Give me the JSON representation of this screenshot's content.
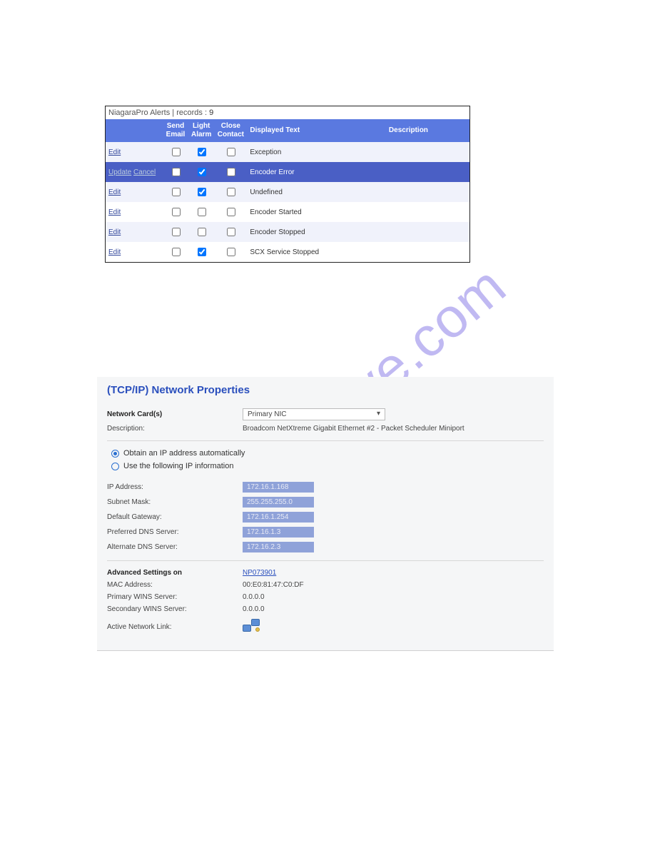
{
  "watermark": "manualshive.com",
  "alerts": {
    "title_prefix": "NiagaraPro Alerts",
    "records_label": "records :",
    "records_count": "9",
    "headers": {
      "action": "",
      "send_email": "Send\nEmail",
      "light_alarm": "Light\nAlarm",
      "close_contact": "Close\nContact",
      "displayed_text": "Displayed Text",
      "description": "Description"
    },
    "edit_label": "Edit",
    "update_label": "Update",
    "cancel_label": "Cancel",
    "rows": [
      {
        "action": "edit",
        "send_email": false,
        "light_alarm": true,
        "close_contact": false,
        "displayed_text": "Exception",
        "description": "",
        "style": "a"
      },
      {
        "action": "update_cancel",
        "send_email": false,
        "light_alarm": true,
        "close_contact": false,
        "displayed_text": "Encoder Error",
        "description": "",
        "style": "sel"
      },
      {
        "action": "edit",
        "send_email": false,
        "light_alarm": true,
        "close_contact": false,
        "displayed_text": "Undefined",
        "description": "",
        "style": "a"
      },
      {
        "action": "edit",
        "send_email": false,
        "light_alarm": false,
        "close_contact": false,
        "displayed_text": "Encoder Started",
        "description": "",
        "style": "b"
      },
      {
        "action": "edit",
        "send_email": false,
        "light_alarm": false,
        "close_contact": false,
        "displayed_text": "Encoder Stopped",
        "description": "",
        "style": "a"
      },
      {
        "action": "edit",
        "send_email": false,
        "light_alarm": true,
        "close_contact": false,
        "displayed_text": "SCX Service Stopped",
        "description": "",
        "style": "b"
      }
    ]
  },
  "network": {
    "title": "(TCP/IP) Network Properties",
    "card_label": "Network Card(s)",
    "card_value": "Primary NIC",
    "desc_label": "Description:",
    "desc_value": "Broadcom NetXtreme Gigabit Ethernet #2 - Packet Scheduler Miniport",
    "radio_auto": "Obtain an IP address automatically",
    "radio_manual": "Use the following IP information",
    "ip_label": "IP Address:",
    "ip_value": "172.16.1.168",
    "subnet_label": "Subnet Mask:",
    "subnet_value": "255.255.255.0",
    "gateway_label": "Default Gateway:",
    "gateway_value": "172.16.1.254",
    "pdns_label": "Preferred DNS Server:",
    "pdns_value": "172.16.1.3",
    "adns_label": "Alternate DNS Server:",
    "adns_value": "172.16.2.3",
    "adv_label": "Advanced Settings on",
    "adv_link": "NP073901",
    "mac_label": "MAC Address:",
    "mac_value": "00:E0:81:47:C0:DF",
    "pwins_label": "Primary WINS Server:",
    "pwins_value": "0.0.0.0",
    "swins_label": "Secondary WINS Server:",
    "swins_value": "0.0.0.0",
    "link_label": "Active Network Link:"
  }
}
